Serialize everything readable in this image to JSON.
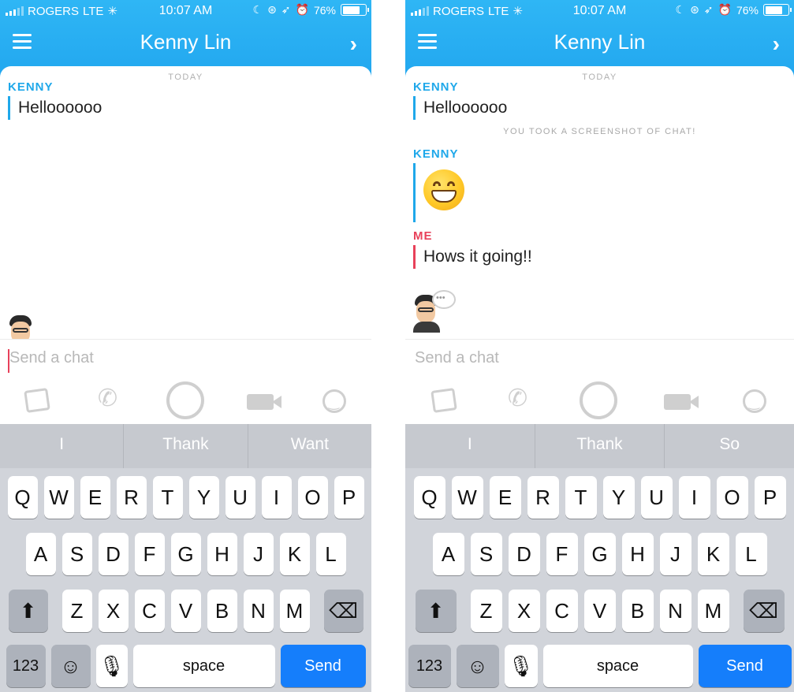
{
  "screens": [
    {
      "status": {
        "carrier": "ROGERS",
        "network": "LTE",
        "time": "10:07 AM",
        "battery": "76%",
        "battery_level": 0.76
      },
      "header": {
        "title": "Kenny Lin"
      },
      "chat": {
        "day_label": "TODAY",
        "sender_kenny": "KENNY",
        "message_1": "Helloooooo"
      },
      "input": {
        "placeholder": "Send a chat"
      },
      "predictions": [
        "I",
        "Thank",
        "Want"
      ]
    },
    {
      "status": {
        "carrier": "ROGERS",
        "network": "LTE",
        "time": "10:07 AM",
        "battery": "76%",
        "battery_level": 0.76
      },
      "header": {
        "title": "Kenny Lin"
      },
      "chat": {
        "day_label": "TODAY",
        "sender_kenny": "KENNY",
        "message_1": "Helloooooo",
        "screenshot_notice": "YOU TOOK A SCREENSHOT OF CHAT!",
        "sender_kenny_2": "KENNY",
        "sender_me": "ME",
        "message_me": "Hows it going!!"
      },
      "input": {
        "placeholder": "Send a chat"
      },
      "predictions": [
        "I",
        "Thank",
        "So"
      ]
    }
  ],
  "keyboard": {
    "row1": [
      "Q",
      "W",
      "E",
      "R",
      "T",
      "Y",
      "U",
      "I",
      "O",
      "P"
    ],
    "row2": [
      "A",
      "S",
      "D",
      "F",
      "G",
      "H",
      "J",
      "K",
      "L"
    ],
    "row3": [
      "Z",
      "X",
      "C",
      "V",
      "B",
      "N",
      "M"
    ],
    "numbers_label": "123",
    "space_label": "space",
    "send_label": "Send"
  },
  "colors": {
    "header": "#22a7ef",
    "kenny": "#1fa8ea",
    "me": "#e8415a",
    "send": "#157efb"
  }
}
